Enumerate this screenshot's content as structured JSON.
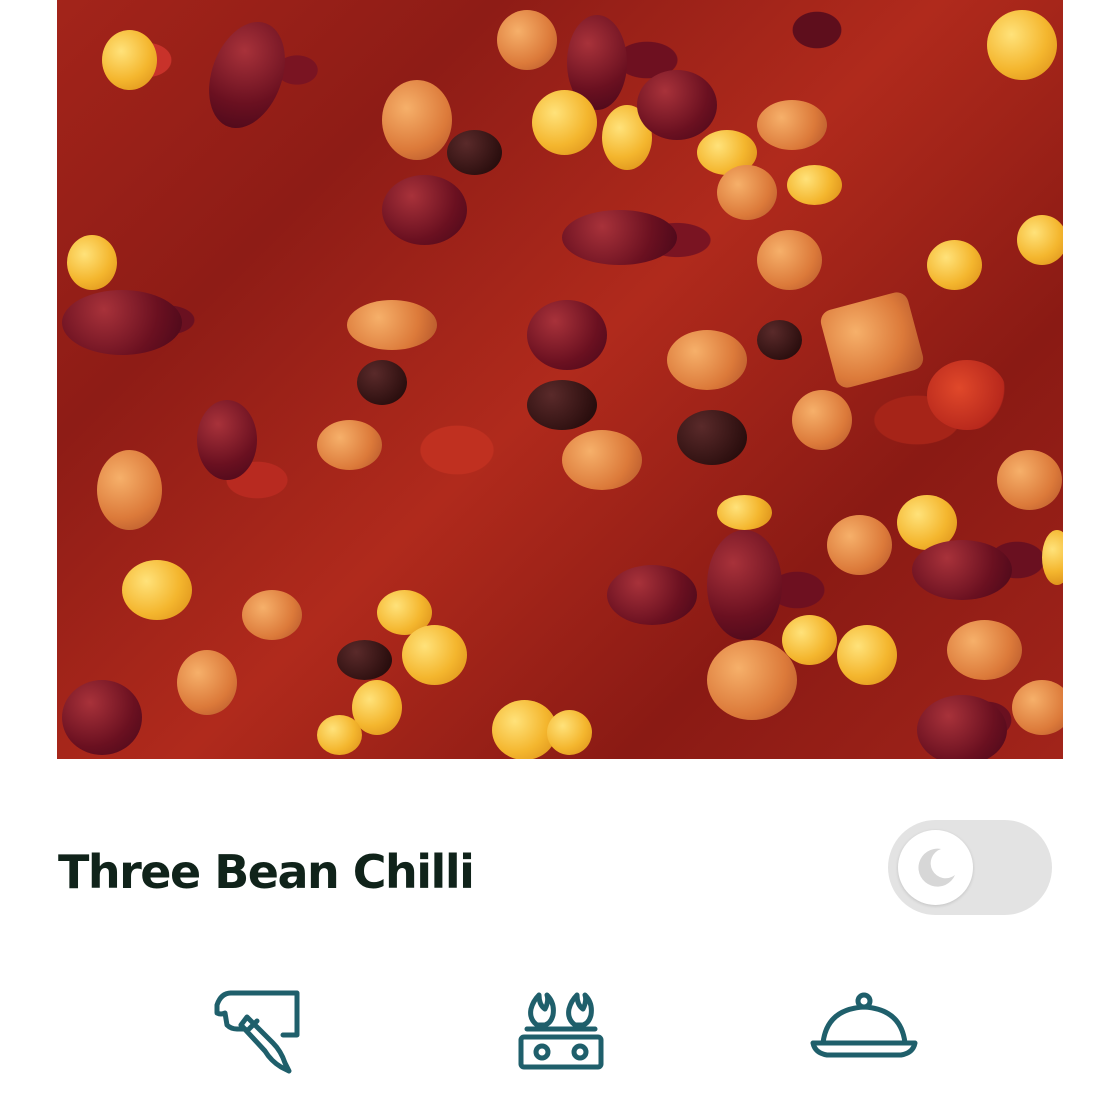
{
  "recipe": {
    "title": "Three Bean Chilli"
  },
  "theme_toggle": {
    "state": "off",
    "icon": "moon-icon"
  },
  "icon_row": [
    {
      "icon": "chopping-board-knife-icon"
    },
    {
      "icon": "stove-burner-icon"
    },
    {
      "icon": "serving-cloche-icon"
    }
  ],
  "colors": {
    "title_text": "#10231a",
    "icon_stroke": "#1f5f6b",
    "toggle_track": "#e3e3e3",
    "toggle_knob": "#ffffff",
    "moon": "#d7d7d7"
  }
}
